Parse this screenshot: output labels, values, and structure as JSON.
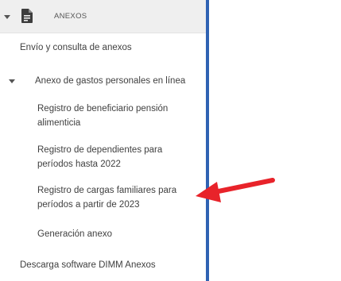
{
  "header": {
    "label": "ANEXOS",
    "icon": "document-icon"
  },
  "menu": {
    "envio": "Envío y consulta de anexos",
    "anexo_gastos": "Anexo de gastos personales en línea",
    "sub_items": [
      "Registro de beneficiario pensión alimenticia",
      "Registro de dependientes para períodos hasta 2022",
      "Registro de cargas familiares para períodos a partir de 2023",
      "Generación anexo"
    ],
    "descarga": "Descarga software DIMM Anexos"
  },
  "colors": {
    "accent_rule": "#2f62b3",
    "arrow": "#e8232a"
  }
}
